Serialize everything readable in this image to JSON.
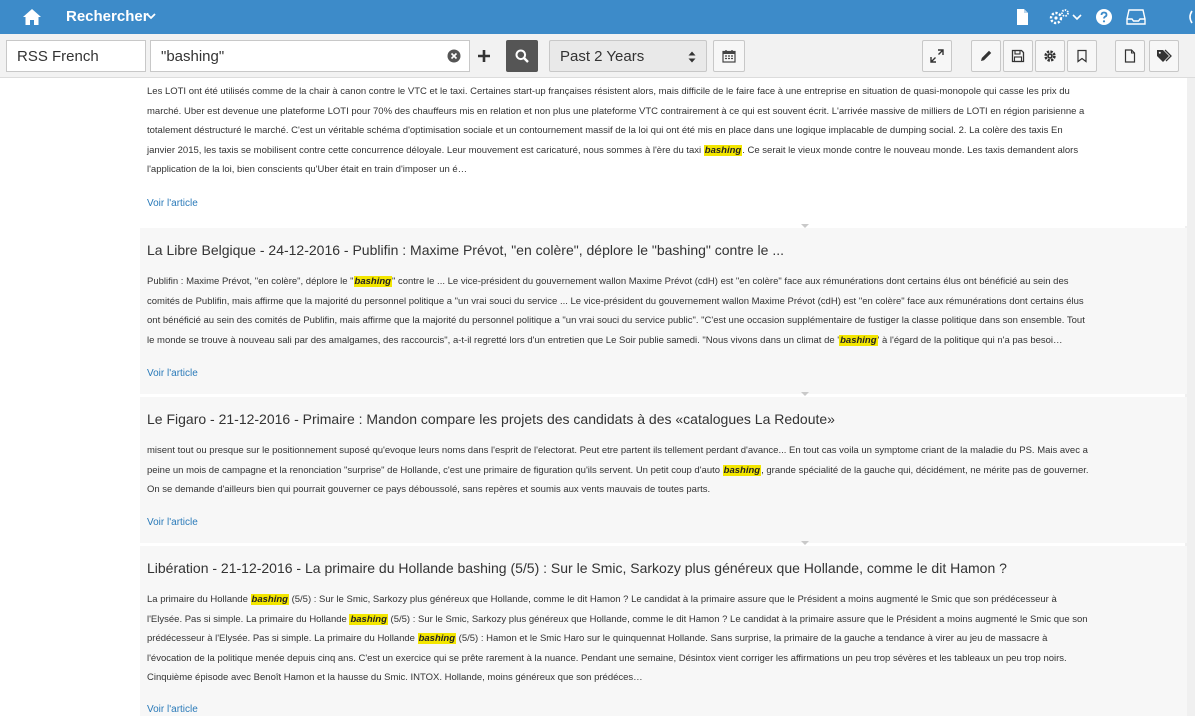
{
  "topbar": {
    "title": "Rechercher",
    "icons": [
      "home-icon",
      "chevron-down-icon",
      "file-icon",
      "cogs-icon",
      "chevron-down-icon",
      "help-icon",
      "inbox-icon"
    ]
  },
  "toolbar": {
    "source": "RSS French",
    "query": "\"bashing\"",
    "period": "Past 2 Years",
    "icons": [
      "clear-icon",
      "plus-icon",
      "search-icon",
      "updown-icon",
      "calendar-icon",
      "expand-icon",
      "pencil-icon",
      "save-icon",
      "gear-icon",
      "bookmark-icon",
      "document-icon",
      "tags-icon"
    ]
  },
  "highlight_term": "bashing",
  "read_more_label": "Voir l'article",
  "results": [
    {
      "title": "",
      "snippet_lines": [
        "Les LOTI ont été utilisés comme de la chair à canon contre le VTC et le taxi. Certaines start-up françaises résistent alors, mais difficile de le faire face à une entreprise en situation de quasi-monopole qui casse les prix du",
        "marché. Uber est devenue une plateforme LOTI pour 70% des chauffeurs mis en relation et non plus une plateforme VTC contrairement à ce qui est souvent écrit. L'arrivée massive de milliers de LOTI en région parisienne a",
        "totalement déstructuré le marché. C'est un véritable schéma d'optimisation sociale et un contournement massif de la loi qui ont été mis en place dans une logique implacable de dumping social. 2. La colère des taxis En",
        "janvier 2015, les taxis se mobilisent contre cette concurrence déloyale. Leur mouvement est caricaturé, nous sommes à l'ère du taxi [[bashing]]. Ce serait le vieux monde contre le nouveau monde. Les taxis demandent alors",
        "l'application de la loi, bien conscients qu'Uber était en train d'imposer un é…"
      ]
    },
    {
      "title": "La Libre Belgique - 24-12-2016 - Publifin : Maxime Prévot, \"en colère\", déplore le \"bashing\" contre le ...",
      "snippet_lines": [
        "Publifin : Maxime Prévot, \"en colère\", déplore le \"[[bashing]]\" contre le ... Le vice-président du gouvernement wallon Maxime Prévot (cdH) est \"en colère\" face aux rémunérations dont certains élus ont bénéficié au sein des",
        "comités de Publifin, mais affirme que la majorité du personnel politique a \"un vrai souci du service ... Le vice-président du gouvernement wallon Maxime Prévot (cdH) est \"en colère\" face aux rémunérations dont certains élus",
        "ont bénéficié au sein des comités de Publifin, mais affirme que la majorité du personnel politique a \"un vrai souci du service public\". \"C'est une occasion supplémentaire de fustiger la classe politique dans son ensemble. Tout",
        "le monde se trouve à nouveau sali par des amalgames, des raccourcis\", a-t-il regretté lors d'un entretien que Le Soir publie samedi. \"Nous vivons dans un climat de '[[bashing]]' à l'égard de la politique qui n'a pas besoi…"
      ]
    },
    {
      "title": "Le Figaro - 21-12-2016 - Primaire : Mandon compare les projets des candidats à des «catalogues La Redoute»",
      "snippet_lines": [
        "misent tout ou presque sur le positionnement suposé qu'evoque leurs noms dans l'esprit de l'electorat. Peut etre partent ils tellement perdant d'avance... En tout cas voila un symptome criant de la maladie du PS. Mais avec a",
        "peine un mois de campagne et la renonciation \"surprise\" de Hollande, c'est une primaire de figuration qu'ils servent. Un petit coup d'auto [[bashing]], grande spécialité de la gauche qui, décidément, ne mérite pas de gouverner.",
        "On se demande d'ailleurs bien qui pourrait gouverner ce pays déboussolé, sans repères et soumis aux vents mauvais de toutes parts."
      ]
    },
    {
      "title": "Libération - 21-12-2016 - La primaire du Hollande bashing (5/5) : Sur le Smic, Sarkozy plus généreux que Hollande, comme le dit Hamon ?",
      "snippet_lines": [
        "La primaire du Hollande [[bashing]] (5/5) : Sur le Smic, Sarkozy plus généreux que Hollande, comme le dit Hamon ? Le candidat à la primaire assure que le Président a moins augmenté le Smic que son prédécesseur à",
        "l'Elysée. Pas si simple. La primaire du Hollande [[bashing]] (5/5) : Sur le Smic, Sarkozy plus généreux que Hollande, comme le dit Hamon ? Le candidat à la primaire assure que le Président a moins augmenté le Smic que son",
        "prédécesseur à l'Elysée. Pas si simple. La primaire du Hollande [[bashing]] (5/5) : Hamon et le Smic Haro sur le quinquennat Hollande. Sans surprise, la primaire de la gauche a tendance à virer au jeu de massacre à",
        "l'évocation de la politique menée depuis cinq ans. C'est un exercice qui se prête rarement à la nuance. Pendant une semaine, Désintox vient corriger les affirmations un peu trop sévères et les tableaux un peu trop noirs.",
        "Cinquième épisode avec Benoît Hamon et la hausse du Smic. INTOX. Hollande, moins généreux que son prédéces…"
      ]
    }
  ]
}
